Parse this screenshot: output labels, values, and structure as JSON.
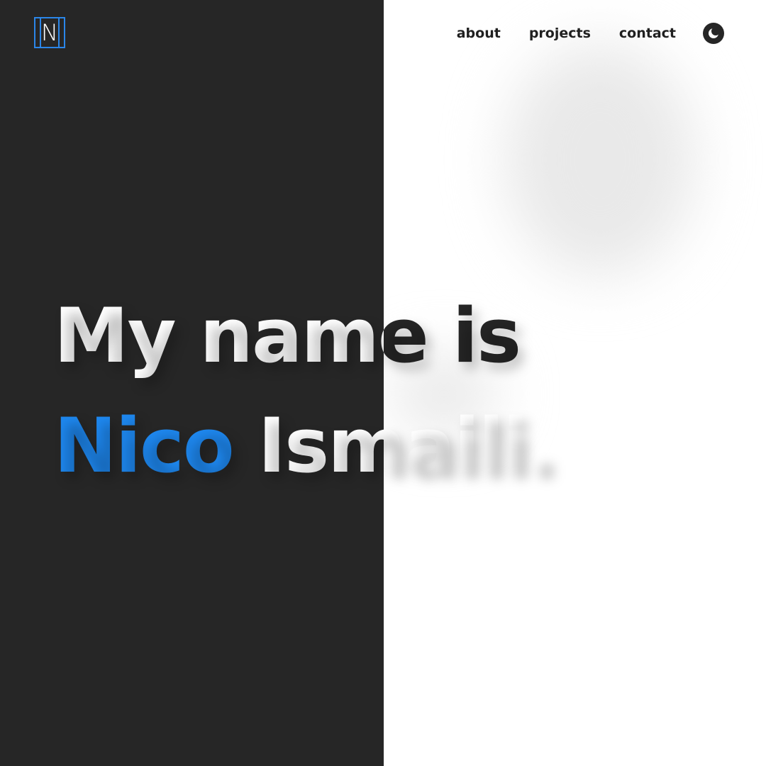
{
  "header": {
    "logo_letter": "N",
    "nav": [
      {
        "label": "about"
      },
      {
        "label": "projects"
      },
      {
        "label": "contact"
      }
    ],
    "theme_toggle_icon": "moon-icon"
  },
  "hero": {
    "line1": "My name is",
    "first_name": "Nico",
    "last_name": "Ismaili."
  },
  "colors": {
    "dark_panel": "#262626",
    "light_panel": "#ffffff",
    "accent": "#1e88f0",
    "logo_border": "#2b86e9"
  }
}
